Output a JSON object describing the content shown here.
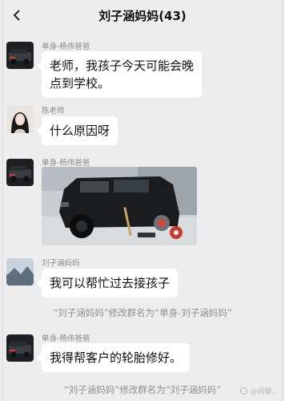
{
  "header": {
    "title": "刘子涵妈妈(43)"
  },
  "messages": [
    {
      "sender": "单身-杨伟爸爸",
      "text": "老师，我孩子今天可能会晚点到学校。"
    },
    {
      "sender": "陈老师",
      "text": "什么原因呀"
    },
    {
      "sender": "单身-杨伟爸爸",
      "image": "black SUV with wheel removed in parking garage"
    },
    {
      "sender": "刘子涵妈妈",
      "text": "我可以帮忙过去接孩子"
    },
    {
      "system": "“刘子涵妈妈”修改群名为“单身-刘子涵妈妈”"
    },
    {
      "sender": "单身-杨伟爸爸",
      "text": "我得帮客户的轮胎修好。"
    },
    {
      "system": "“刘子涵妈妈”修改群名为“刘子涵妈妈”"
    }
  ],
  "watermark": "@闲聊..."
}
